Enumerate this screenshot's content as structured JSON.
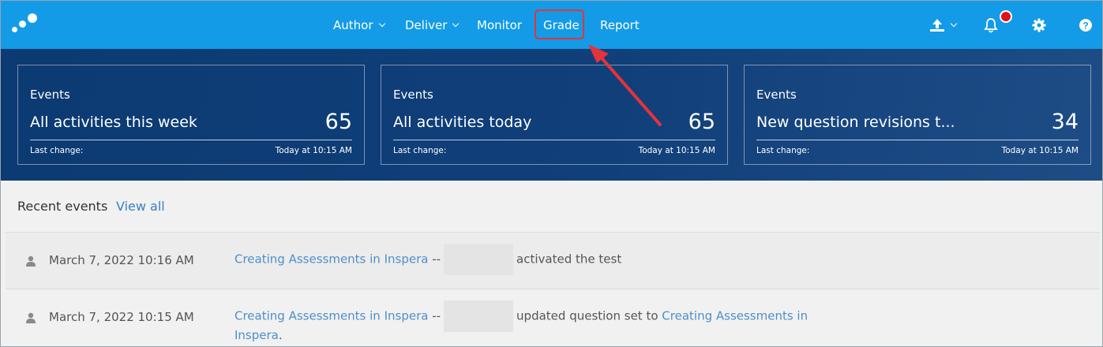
{
  "nav": {
    "items": [
      {
        "label": "Author",
        "dropdown": true
      },
      {
        "label": "Deliver",
        "dropdown": true
      },
      {
        "label": "Monitor",
        "dropdown": false
      },
      {
        "label": "Grade",
        "dropdown": false,
        "highlighted": true
      },
      {
        "label": "Report",
        "dropdown": false
      }
    ],
    "icons": [
      "upload-icon",
      "bell-icon",
      "gear-icon",
      "help-icon"
    ]
  },
  "cards": [
    {
      "title": "Events",
      "description": "All activities this week",
      "count": "65",
      "last_change_label": "Last change:",
      "last_change_value": "Today at 10:15 AM"
    },
    {
      "title": "Events",
      "description": "All activities today",
      "count": "65",
      "last_change_label": "Last change:",
      "last_change_value": "Today at 10:15 AM"
    },
    {
      "title": "Events",
      "description": "New question revisions t...",
      "count": "34",
      "last_change_label": "Last change:",
      "last_change_value": "Today at 10:15 AM"
    }
  ],
  "recent": {
    "title": "Recent events",
    "view_all": "View all",
    "rows": [
      {
        "date": "March 7, 2022 10:16 AM",
        "link": "Creating Assessments in Inspera",
        "separator": "--",
        "action": "activated the test"
      },
      {
        "date": "March 7, 2022 10:15 AM",
        "link": "Creating Assessments in Inspera",
        "separator": "--",
        "action": "updated question set to",
        "target_link_1": "Creating Assessments in",
        "target_link_2": "Inspera",
        "suffix": "."
      }
    ]
  },
  "colors": {
    "topbar": "#139be7",
    "hero": "#0c3a72",
    "link": "#4e8fc9",
    "annotation": "#e5333a",
    "notification_badge": "#e0101c"
  }
}
